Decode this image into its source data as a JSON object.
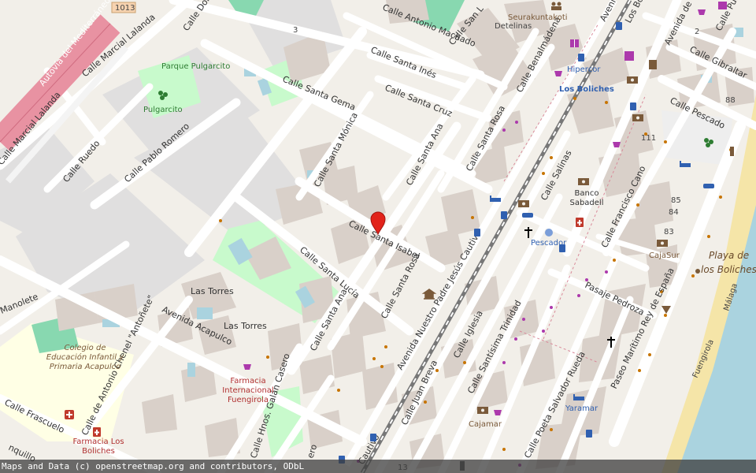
{
  "map": {
    "streets": {
      "autovia": "Autovía del Mediterráneo",
      "road_ref": "1013",
      "marcial_lalanda_1": "Calle Marcial Lalanda",
      "marcial_lalanda_2": "Calle Marcial Lalanda",
      "domingo": "Calle Domin",
      "antonio_machado": "Calle Antonio Machado",
      "san_l": "Calle San L",
      "santa_ines": "Calle Santa Inés",
      "santa_gema": "Calle Santa Gema",
      "santa_cruz": "Calle Santa Cruz",
      "santa_monica": "Calle Santa Mónica",
      "santa_ana_1": "Calle Santa Ana",
      "santa_rosa_1": "Calle Santa Rosa",
      "benalmadena": "Calle Benalmádena",
      "avenida_top": "Avenida",
      "los_bo": "Los Bo",
      "avenida_de": "Avenida de",
      "pulpo": "Calle Pulpo",
      "gibraltar": "Calle Gibraltar",
      "pescado": "Calle Pescado",
      "salinas": "Calle Salinas",
      "francisco_cano": "Calle Francisco Cano",
      "ruedo": "Calle Ruedo",
      "pablo_romero": "Calle Pablo Romero",
      "santa_isabel": "Calle Santa Isabel",
      "santa_lucia": "Calle Santa Lucía",
      "santa_ana_2": "Calle Santa Ana",
      "santa_rosa_2": "Calle Santa Rosa",
      "nuestro_padre": "Avenida Nuestro Padre Jesús Cautivo",
      "iglesia": "Calle Iglesia",
      "santisima_trinidad": "Calle Santísima Trinidad",
      "juan_breva": "Calle Juan Breva",
      "poeta_salvador_rueda": "Calle Poeta Salvador Rueda",
      "pasaje_pedroza": "Pasaje Pedroza",
      "paseo_maritimo": "Paseo Marítimo Rey de España",
      "manolete": "Manolete",
      "acapulco": "Avenida Acapulco",
      "antonio_chenel": "Calle de Antonio Chenel \"Antoñete\"",
      "frascuelo": "Calle Frascuelo",
      "hnos_galan": "Calle Hnos. Galán Casero",
      "cautivo_bottom": "Cautivo",
      "malaga": "Málaga",
      "fuengirola": "Fuengirola",
      "nquillo": "nquillo",
      "ero": "ero"
    },
    "places": {
      "parque": "Parque Pulgarcito",
      "pulgarcito": "Pulgarcito",
      "las_torres_1": "Las Torres",
      "las_torres_2": "Las Torres",
      "colegio": "Colegio de Educación Infantil y Primaria Acapulco",
      "farmacia_intl": "Farmacia Internacional Fuengirola",
      "farmacia_lb": "Farmacia Los Boliches",
      "seurakuntakoti": "Seurakuntakoti",
      "detelinas": "Detelinas",
      "hipercor": "Hipercor",
      "los_boliches": "Los Boliches",
      "banco_sabadell": "Banco Sabadell",
      "pescador": "Pescador",
      "cajasur": "CajaSur",
      "cajamar": "Cajamar",
      "yaramar": "Yaramar",
      "playa": "Playa de los Boliches"
    },
    "house_numbers": [
      "3",
      "2",
      "88",
      "111",
      "85",
      "84",
      "83",
      "13"
    ],
    "marker": "location-pin"
  },
  "attribution": "Maps and Data (c) openstreetmap.org and contributors, ODbL",
  "colors": {
    "background": "#f2efe9",
    "building": "#d9d0c9",
    "road": "#ffffff",
    "highway": "#e892a2",
    "park": "#c8facc",
    "beach": "#f5e5a8",
    "sea": "#aad3df",
    "school": "#ffffe5",
    "marker": "#e2231a",
    "railway": "#555555"
  }
}
